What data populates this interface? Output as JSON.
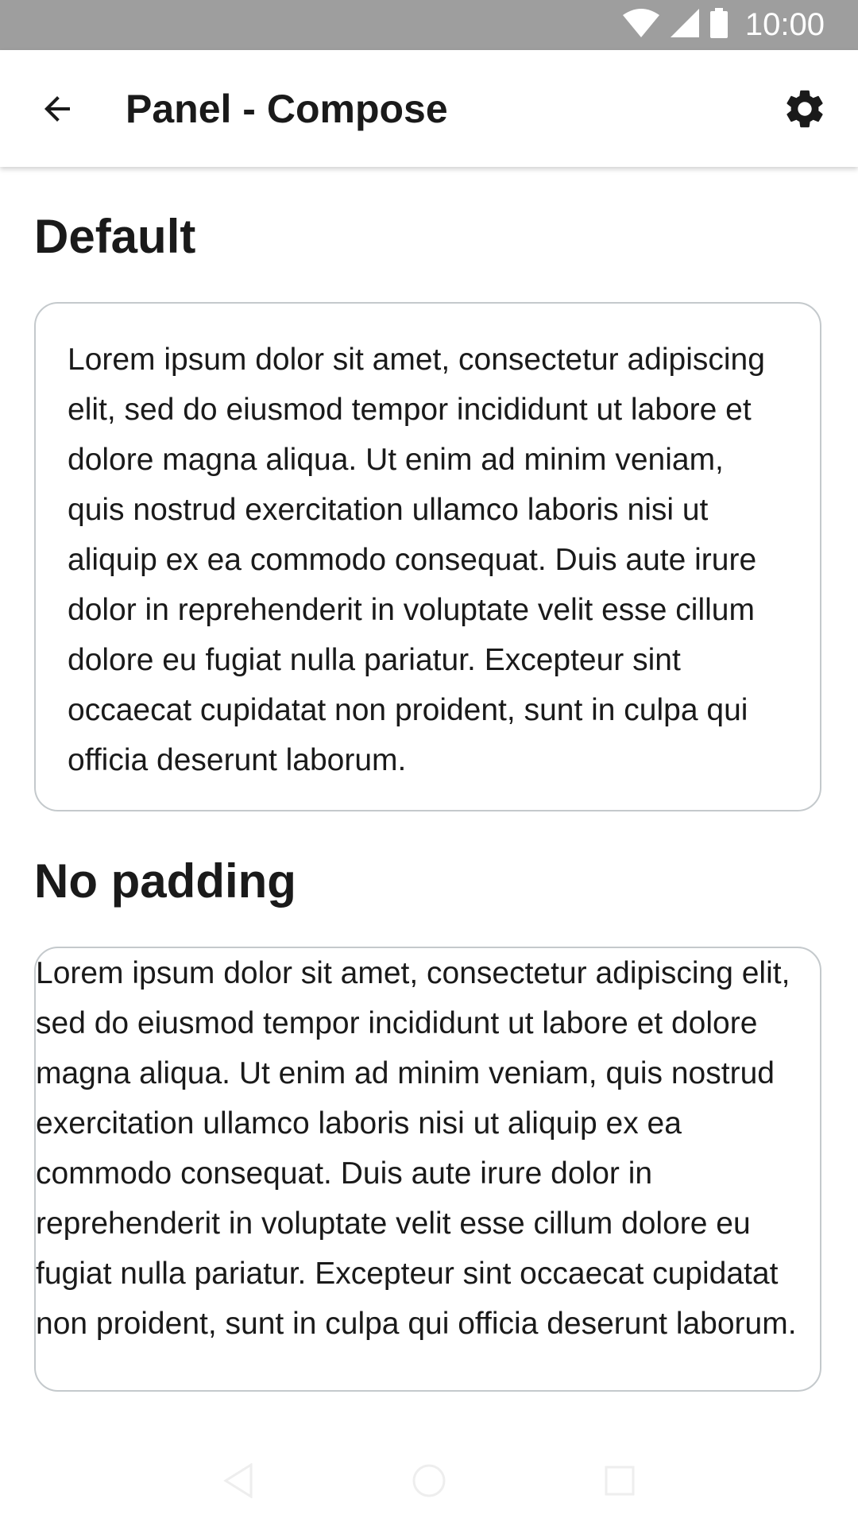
{
  "status_bar": {
    "time": "10:00",
    "icons": [
      "wifi-icon",
      "cell-signal-icon",
      "battery-icon"
    ]
  },
  "app_bar": {
    "title": "Panel - Compose",
    "back_icon": "arrow-back-icon",
    "settings_icon": "gear-icon"
  },
  "sections": [
    {
      "title": "Default",
      "text": "Lorem ipsum dolor sit amet, consectetur adipiscing elit, sed do eiusmod tempor incididunt ut labore et dolore magna aliqua. Ut enim ad minim veniam, quis nostrud exercitation ullamco laboris nisi ut aliquip ex ea commodo consequat. Duis aute irure dolor in reprehenderit in voluptate velit esse cillum dolore eu fugiat nulla pariatur. Excepteur sint occaecat cupidatat non proident, sunt in culpa qui officia deserunt laborum."
    },
    {
      "title": "No padding",
      "text": "Lorem ipsum dolor sit amet, consectetur adipiscing elit, sed do eiusmod tempor incididunt ut labore et dolore magna aliqua. Ut enim ad minim veniam, quis nostrud exercitation ullamco laboris nisi ut aliquip ex ea commodo consequat. Duis aute irure dolor in reprehenderit in voluptate velit esse cillum dolore eu fugiat nulla pariatur. Excepteur sint occaecat cupidatat non proident, sunt in culpa qui officia deserunt laborum."
    }
  ],
  "nav_bar": {
    "icons": [
      "back-triangle-icon",
      "home-circle-icon",
      "recents-square-icon"
    ]
  },
  "colors": {
    "status_bar": "#9e9e9e",
    "panel_border": "#c4c9cc",
    "text": "#1a1a1a"
  }
}
